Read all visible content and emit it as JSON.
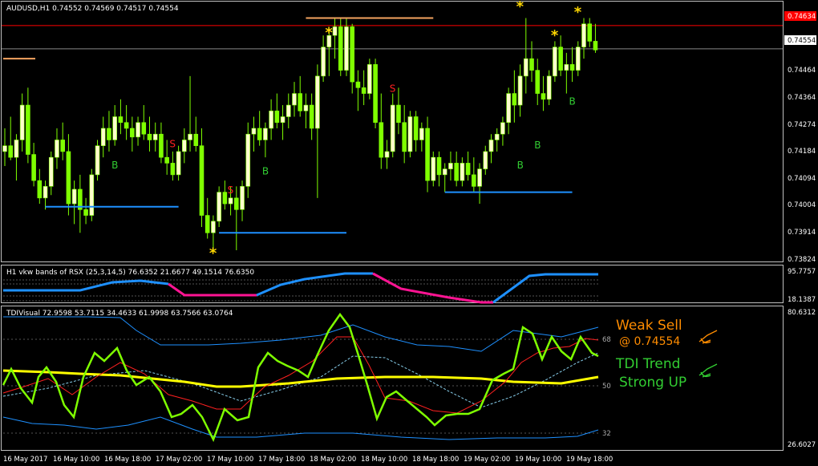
{
  "colors": {
    "background": "#000000",
    "frame": "#c0c0c0",
    "candle_bull": "#ffffcc",
    "candle_bear": "#7fff00",
    "buy_signal": "#32cd32",
    "sell_signal": "#ff2020",
    "star": "#ffd700",
    "support": "#1e90ff",
    "resistance": "#f4a460",
    "bid_line": "#ff0000",
    "rsx_up": "#1e90ff",
    "rsx_down": "#ff1493",
    "tdi_price": "#7fff00",
    "tdi_signal": "#ff2020",
    "tdi_market_base": "#ffff00",
    "tdi_bands": "#1e90ff",
    "weak_sell": "#ff8c00",
    "tdi_trend": "#32cd32"
  },
  "main": {
    "title": "AUDUSD,H1  0.74552 0.74569 0.74517 0.74554",
    "price_labels": [
      "0.74634",
      "0.74554",
      "0.74464",
      "0.74364",
      "0.74274",
      "0.74184",
      "0.74094",
      "0.74004",
      "0.73914",
      "0.73824"
    ],
    "markers": {
      "buy": "B",
      "sell": "S",
      "star": "*"
    },
    "bid_tag": "0.74554",
    "high_tag": "0.74634"
  },
  "rsx": {
    "title": "H1 vkw bands of RSX (25,3,14,5) 76.6352 21.6677 49.1514 76.6350",
    "scale_top": "95.7757",
    "scale_bottom": "18.1387"
  },
  "tdi": {
    "title": "TDIVisual 72.9598 53.7115 34.4633 61.9998 63.7566 63.0764",
    "scale_top": "80.6312",
    "scale_bottom": "26.6027",
    "level_68": "68",
    "level_50": "50",
    "level_32": "32",
    "status_1": "Weak Sell",
    "status_2": "@ 0.74554",
    "trend_1": "TDI Trend",
    "trend_2": "Strong UP"
  },
  "time_labels": [
    "16 May 2017",
    "16 May 10:00",
    "16 May 18:00",
    "17 May 02:00",
    "17 May 10:00",
    "17 May 18:00",
    "18 May 02:00",
    "18 May 10:00",
    "18 May 18:00",
    "19 May 02:00",
    "19 May 10:00",
    "19 May 18:00"
  ],
  "chart_data": {
    "type": "candlestick",
    "symbol": "AUDUSD",
    "timeframe": "H1",
    "ylim": [
      0.73824,
      0.747
    ],
    "candles": [
      [
        0.742,
        0.7428,
        0.7415,
        0.7422
      ],
      [
        0.7422,
        0.7432,
        0.7417,
        0.7418
      ],
      [
        0.7418,
        0.7426,
        0.741,
        0.7424
      ],
      [
        0.7424,
        0.744,
        0.742,
        0.7436
      ],
      [
        0.7436,
        0.7442,
        0.7416,
        0.7419
      ],
      [
        0.7419,
        0.7423,
        0.7408,
        0.741
      ],
      [
        0.741,
        0.7414,
        0.7402,
        0.7404
      ],
      [
        0.7404,
        0.741,
        0.74,
        0.7408
      ],
      [
        0.7408,
        0.742,
        0.7405,
        0.7418
      ],
      [
        0.7418,
        0.7428,
        0.7414,
        0.7424
      ],
      [
        0.7424,
        0.743,
        0.7417,
        0.742
      ],
      [
        0.742,
        0.7426,
        0.7398,
        0.7402
      ],
      [
        0.7402,
        0.741,
        0.7395,
        0.7407
      ],
      [
        0.7407,
        0.7412,
        0.7392,
        0.74
      ],
      [
        0.74,
        0.7404,
        0.7395,
        0.7398
      ],
      [
        0.7398,
        0.7414,
        0.7396,
        0.7412
      ],
      [
        0.7412,
        0.7424,
        0.741,
        0.7422
      ],
      [
        0.7422,
        0.7432,
        0.7418,
        0.7428
      ],
      [
        0.7428,
        0.7434,
        0.742,
        0.7424
      ],
      [
        0.7424,
        0.7436,
        0.7422,
        0.7432
      ],
      [
        0.7432,
        0.7438,
        0.7426,
        0.743
      ],
      [
        0.743,
        0.7436,
        0.7424,
        0.7428
      ],
      [
        0.7428,
        0.7432,
        0.742,
        0.7425
      ],
      [
        0.7425,
        0.7432,
        0.7422,
        0.743
      ],
      [
        0.743,
        0.7436,
        0.7424,
        0.7426
      ],
      [
        0.7426,
        0.7432,
        0.742,
        0.7424
      ],
      [
        0.7424,
        0.743,
        0.742,
        0.7426
      ],
      [
        0.7426,
        0.743,
        0.7416,
        0.7418
      ],
      [
        0.7418,
        0.7424,
        0.7412,
        0.7416
      ],
      [
        0.7416,
        0.742,
        0.741,
        0.7412
      ],
      [
        0.7412,
        0.7422,
        0.741,
        0.742
      ],
      [
        0.742,
        0.7428,
        0.7416,
        0.7424
      ],
      [
        0.7424,
        0.7446,
        0.742,
        0.7426
      ],
      [
        0.7426,
        0.7432,
        0.742,
        0.7422
      ],
      [
        0.7422,
        0.7428,
        0.7394,
        0.7398
      ],
      [
        0.7398,
        0.7404,
        0.739,
        0.7392
      ],
      [
        0.7392,
        0.7398,
        0.7386,
        0.7396
      ],
      [
        0.7396,
        0.7408,
        0.7394,
        0.7406
      ],
      [
        0.7406,
        0.741,
        0.74,
        0.7402
      ],
      [
        0.7402,
        0.7408,
        0.7398,
        0.7404
      ],
      [
        0.7404,
        0.7408,
        0.7386,
        0.74
      ],
      [
        0.74,
        0.741,
        0.7396,
        0.7408
      ],
      [
        0.7408,
        0.743,
        0.7404,
        0.7426
      ],
      [
        0.7426,
        0.7432,
        0.742,
        0.7428
      ],
      [
        0.7428,
        0.7434,
        0.7422,
        0.7424
      ],
      [
        0.7424,
        0.743,
        0.7418,
        0.7428
      ],
      [
        0.7428,
        0.7438,
        0.7424,
        0.7434
      ],
      [
        0.7434,
        0.744,
        0.7428,
        0.743
      ],
      [
        0.743,
        0.7436,
        0.7424,
        0.7432
      ],
      [
        0.7432,
        0.744,
        0.7428,
        0.7436
      ],
      [
        0.7436,
        0.7444,
        0.7432,
        0.744
      ],
      [
        0.744,
        0.7446,
        0.7432,
        0.7434
      ],
      [
        0.7434,
        0.744,
        0.7428,
        0.7436
      ],
      [
        0.7436,
        0.744,
        0.7424,
        0.7428
      ],
      [
        0.7428,
        0.745,
        0.7404,
        0.7446
      ],
      [
        0.7446,
        0.746,
        0.7444,
        0.7456
      ],
      [
        0.7456,
        0.7462,
        0.7446,
        0.746
      ],
      [
        0.746,
        0.7466,
        0.7452,
        0.7463
      ],
      [
        0.7463,
        0.7466,
        0.7446,
        0.7448
      ],
      [
        0.7448,
        0.7466,
        0.7446,
        0.7463
      ],
      [
        0.7463,
        0.7464,
        0.744,
        0.7444
      ],
      [
        0.7444,
        0.7448,
        0.7434,
        0.7442
      ],
      [
        0.7442,
        0.7448,
        0.7436,
        0.744
      ],
      [
        0.744,
        0.7452,
        0.7438,
        0.745
      ],
      [
        0.745,
        0.7452,
        0.7428,
        0.743
      ],
      [
        0.743,
        0.744,
        0.7414,
        0.7418
      ],
      [
        0.7418,
        0.7424,
        0.7414,
        0.742
      ],
      [
        0.742,
        0.744,
        0.7418,
        0.7436
      ],
      [
        0.7436,
        0.7442,
        0.7426,
        0.743
      ],
      [
        0.743,
        0.7436,
        0.7416,
        0.742
      ],
      [
        0.742,
        0.7434,
        0.7418,
        0.7432
      ],
      [
        0.7432,
        0.7434,
        0.742,
        0.7424
      ],
      [
        0.7424,
        0.743,
        0.742,
        0.7428
      ],
      [
        0.7428,
        0.7432,
        0.7406,
        0.741
      ],
      [
        0.741,
        0.742,
        0.7408,
        0.7418
      ],
      [
        0.7418,
        0.742,
        0.7408,
        0.7412
      ],
      [
        0.7412,
        0.7416,
        0.7406,
        0.7414
      ],
      [
        0.7414,
        0.742,
        0.741,
        0.7416
      ],
      [
        0.7416,
        0.742,
        0.7408,
        0.741
      ],
      [
        0.741,
        0.7418,
        0.7408,
        0.7416
      ],
      [
        0.7416,
        0.742,
        0.741,
        0.7412
      ],
      [
        0.7412,
        0.7418,
        0.7406,
        0.7408
      ],
      [
        0.7408,
        0.7416,
        0.7402,
        0.7414
      ],
      [
        0.7414,
        0.7422,
        0.7412,
        0.742
      ],
      [
        0.742,
        0.7426,
        0.7416,
        0.7424
      ],
      [
        0.7424,
        0.7428,
        0.742,
        0.7426
      ],
      [
        0.7426,
        0.7432,
        0.7422,
        0.743
      ],
      [
        0.743,
        0.7442,
        0.7426,
        0.744
      ],
      [
        0.744,
        0.7448,
        0.743,
        0.7436
      ],
      [
        0.7436,
        0.745,
        0.7432,
        0.7446
      ],
      [
        0.7446,
        0.7466,
        0.744,
        0.7452
      ],
      [
        0.7452,
        0.7458,
        0.7444,
        0.7448
      ],
      [
        0.7448,
        0.7452,
        0.7436,
        0.744
      ],
      [
        0.744,
        0.7446,
        0.7434,
        0.7438
      ],
      [
        0.7438,
        0.7448,
        0.7436,
        0.7446
      ],
      [
        0.7446,
        0.7458,
        0.7444,
        0.7456
      ],
      [
        0.7456,
        0.746,
        0.7446,
        0.7448
      ],
      [
        0.7448,
        0.7454,
        0.744,
        0.745
      ],
      [
        0.745,
        0.7456,
        0.7444,
        0.7448
      ],
      [
        0.7448,
        0.7458,
        0.7446,
        0.7456
      ],
      [
        0.7456,
        0.7466,
        0.7452,
        0.7464
      ],
      [
        0.7464,
        0.7466,
        0.7456,
        0.7458
      ],
      [
        0.7458,
        0.7464,
        0.7454,
        0.7455
      ]
    ],
    "support_levels": [
      0.7401,
      0.7392,
      0.7406
    ],
    "resistance_levels": [
      0.7466,
      0.7452
    ],
    "bid": 0.74554,
    "rsx_bands_ylim": [
      18.1387,
      95.7757
    ],
    "tdi_ylim": [
      26.6027,
      80.6312
    ]
  }
}
